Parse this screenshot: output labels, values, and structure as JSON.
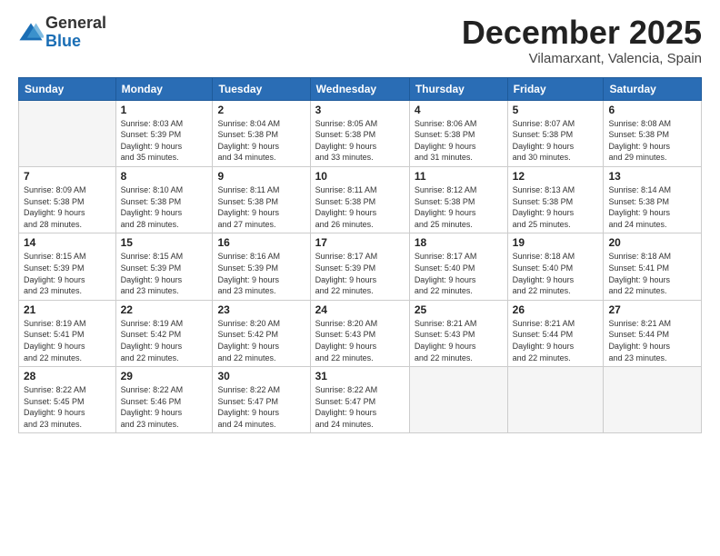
{
  "logo": {
    "general": "General",
    "blue": "Blue"
  },
  "title": "December 2025",
  "location": "Vilamarxant, Valencia, Spain",
  "headers": [
    "Sunday",
    "Monday",
    "Tuesday",
    "Wednesday",
    "Thursday",
    "Friday",
    "Saturday"
  ],
  "weeks": [
    [
      {
        "day": "",
        "info": ""
      },
      {
        "day": "1",
        "info": "Sunrise: 8:03 AM\nSunset: 5:39 PM\nDaylight: 9 hours\nand 35 minutes."
      },
      {
        "day": "2",
        "info": "Sunrise: 8:04 AM\nSunset: 5:38 PM\nDaylight: 9 hours\nand 34 minutes."
      },
      {
        "day": "3",
        "info": "Sunrise: 8:05 AM\nSunset: 5:38 PM\nDaylight: 9 hours\nand 33 minutes."
      },
      {
        "day": "4",
        "info": "Sunrise: 8:06 AM\nSunset: 5:38 PM\nDaylight: 9 hours\nand 31 minutes."
      },
      {
        "day": "5",
        "info": "Sunrise: 8:07 AM\nSunset: 5:38 PM\nDaylight: 9 hours\nand 30 minutes."
      },
      {
        "day": "6",
        "info": "Sunrise: 8:08 AM\nSunset: 5:38 PM\nDaylight: 9 hours\nand 29 minutes."
      }
    ],
    [
      {
        "day": "7",
        "info": "Sunrise: 8:09 AM\nSunset: 5:38 PM\nDaylight: 9 hours\nand 28 minutes."
      },
      {
        "day": "8",
        "info": "Sunrise: 8:10 AM\nSunset: 5:38 PM\nDaylight: 9 hours\nand 28 minutes."
      },
      {
        "day": "9",
        "info": "Sunrise: 8:11 AM\nSunset: 5:38 PM\nDaylight: 9 hours\nand 27 minutes."
      },
      {
        "day": "10",
        "info": "Sunrise: 8:11 AM\nSunset: 5:38 PM\nDaylight: 9 hours\nand 26 minutes."
      },
      {
        "day": "11",
        "info": "Sunrise: 8:12 AM\nSunset: 5:38 PM\nDaylight: 9 hours\nand 25 minutes."
      },
      {
        "day": "12",
        "info": "Sunrise: 8:13 AM\nSunset: 5:38 PM\nDaylight: 9 hours\nand 25 minutes."
      },
      {
        "day": "13",
        "info": "Sunrise: 8:14 AM\nSunset: 5:38 PM\nDaylight: 9 hours\nand 24 minutes."
      }
    ],
    [
      {
        "day": "14",
        "info": "Sunrise: 8:15 AM\nSunset: 5:39 PM\nDaylight: 9 hours\nand 23 minutes."
      },
      {
        "day": "15",
        "info": "Sunrise: 8:15 AM\nSunset: 5:39 PM\nDaylight: 9 hours\nand 23 minutes."
      },
      {
        "day": "16",
        "info": "Sunrise: 8:16 AM\nSunset: 5:39 PM\nDaylight: 9 hours\nand 23 minutes."
      },
      {
        "day": "17",
        "info": "Sunrise: 8:17 AM\nSunset: 5:39 PM\nDaylight: 9 hours\nand 22 minutes."
      },
      {
        "day": "18",
        "info": "Sunrise: 8:17 AM\nSunset: 5:40 PM\nDaylight: 9 hours\nand 22 minutes."
      },
      {
        "day": "19",
        "info": "Sunrise: 8:18 AM\nSunset: 5:40 PM\nDaylight: 9 hours\nand 22 minutes."
      },
      {
        "day": "20",
        "info": "Sunrise: 8:18 AM\nSunset: 5:41 PM\nDaylight: 9 hours\nand 22 minutes."
      }
    ],
    [
      {
        "day": "21",
        "info": "Sunrise: 8:19 AM\nSunset: 5:41 PM\nDaylight: 9 hours\nand 22 minutes."
      },
      {
        "day": "22",
        "info": "Sunrise: 8:19 AM\nSunset: 5:42 PM\nDaylight: 9 hours\nand 22 minutes."
      },
      {
        "day": "23",
        "info": "Sunrise: 8:20 AM\nSunset: 5:42 PM\nDaylight: 9 hours\nand 22 minutes."
      },
      {
        "day": "24",
        "info": "Sunrise: 8:20 AM\nSunset: 5:43 PM\nDaylight: 9 hours\nand 22 minutes."
      },
      {
        "day": "25",
        "info": "Sunrise: 8:21 AM\nSunset: 5:43 PM\nDaylight: 9 hours\nand 22 minutes."
      },
      {
        "day": "26",
        "info": "Sunrise: 8:21 AM\nSunset: 5:44 PM\nDaylight: 9 hours\nand 22 minutes."
      },
      {
        "day": "27",
        "info": "Sunrise: 8:21 AM\nSunset: 5:44 PM\nDaylight: 9 hours\nand 23 minutes."
      }
    ],
    [
      {
        "day": "28",
        "info": "Sunrise: 8:22 AM\nSunset: 5:45 PM\nDaylight: 9 hours\nand 23 minutes."
      },
      {
        "day": "29",
        "info": "Sunrise: 8:22 AM\nSunset: 5:46 PM\nDaylight: 9 hours\nand 23 minutes."
      },
      {
        "day": "30",
        "info": "Sunrise: 8:22 AM\nSunset: 5:47 PM\nDaylight: 9 hours\nand 24 minutes."
      },
      {
        "day": "31",
        "info": "Sunrise: 8:22 AM\nSunset: 5:47 PM\nDaylight: 9 hours\nand 24 minutes."
      },
      {
        "day": "",
        "info": ""
      },
      {
        "day": "",
        "info": ""
      },
      {
        "day": "",
        "info": ""
      }
    ]
  ]
}
